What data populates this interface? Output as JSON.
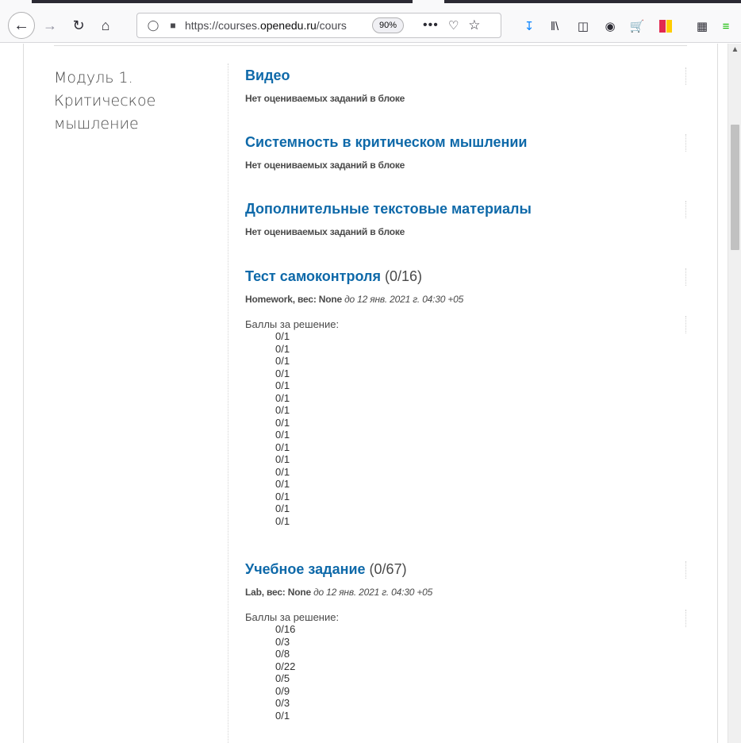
{
  "browser": {
    "url_prefix": "https://courses.",
    "url_domain": "openedu.ru",
    "url_suffix": "/cours",
    "zoom": "90%",
    "more_label": "•••",
    "icons": [
      "back-icon",
      "forward-icon",
      "reload-icon",
      "home-icon",
      "shield-icon",
      "lock-icon",
      "pocket-icon",
      "star-icon",
      "download-icon",
      "library-icon",
      "sidebar-icon",
      "account-icon",
      "cart-icon",
      "bookmark-flag-icon",
      "extension-icon",
      "menu-update-icon"
    ]
  },
  "chapter": {
    "title": "Модуль 1. Критическое мышление"
  },
  "sections": [
    {
      "title": "Видео",
      "count": "",
      "subtitle": "Нет оцениваемых заданий в блоке"
    },
    {
      "title": "Системность в критическом мышлении",
      "count": "",
      "subtitle": "Нет оцениваемых заданий в блоке"
    },
    {
      "title": "Дополнительные текстовые материалы",
      "count": "",
      "subtitle": "Нет оцениваемых заданий в блоке"
    },
    {
      "title": "Тест самоконтроля",
      "count": "(0/16)",
      "subtitle_type": "Homework, вес: None",
      "subtitle_due": "до 12 янв. 2021 г. 04:30 +05",
      "scores_label": "Баллы за решение:",
      "scores": [
        "0/1",
        "0/1",
        "0/1",
        "0/1",
        "0/1",
        "0/1",
        "0/1",
        "0/1",
        "0/1",
        "0/1",
        "0/1",
        "0/1",
        "0/1",
        "0/1",
        "0/1",
        "0/1"
      ]
    },
    {
      "title": "Учебное задание",
      "count": "(0/67)",
      "subtitle_type": "Lab, вес: None",
      "subtitle_due": "до 12 янв. 2021 г. 04:30 +05",
      "scores_label": "Баллы за решение:",
      "scores": [
        "0/16",
        "0/3",
        "0/8",
        "0/22",
        "0/5",
        "0/9",
        "0/3",
        "0/1"
      ]
    }
  ]
}
